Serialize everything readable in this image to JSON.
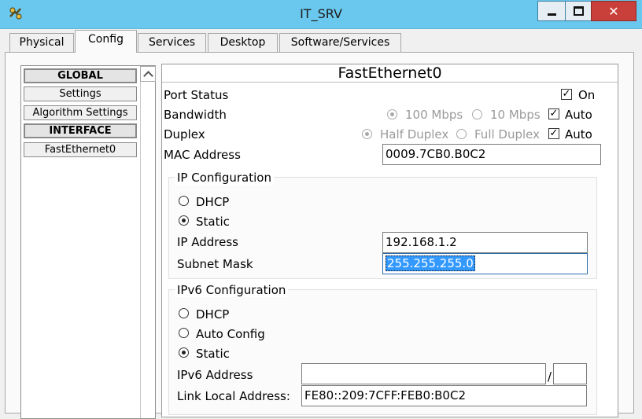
{
  "window": {
    "title": "IT_SRV",
    "close_glyph": "✕"
  },
  "tabs": [
    {
      "label": "Physical"
    },
    {
      "label": "Config"
    },
    {
      "label": "Services"
    },
    {
      "label": "Desktop"
    },
    {
      "label": "Software/Services"
    }
  ],
  "sidebar": {
    "items": [
      {
        "label": "GLOBAL"
      },
      {
        "label": "Settings"
      },
      {
        "label": "Algorithm Settings"
      },
      {
        "label": "INTERFACE"
      },
      {
        "label": "FastEthernet0"
      }
    ]
  },
  "panel": {
    "title": "FastEthernet0",
    "port_status": {
      "label": "Port Status",
      "on_label": "On",
      "checked": true
    },
    "bandwidth": {
      "label": "Bandwidth",
      "opt1": "100 Mbps",
      "opt2": "10 Mbps",
      "auto_label": "Auto"
    },
    "duplex": {
      "label": "Duplex",
      "opt1": "Half Duplex",
      "opt2": "Full Duplex",
      "auto_label": "Auto"
    },
    "mac": {
      "label": "MAC Address",
      "value": "0009.7CB0.B0C2"
    },
    "ip_config": {
      "title": "IP Configuration",
      "dhcp_label": "DHCP",
      "static_label": "Static",
      "ip_label": "IP Address",
      "ip_value": "192.168.1.2",
      "mask_label": "Subnet Mask",
      "mask_value": "255.255.255.0"
    },
    "ipv6_config": {
      "title": "IPv6 Configuration",
      "dhcp_label": "DHCP",
      "auto_label": "Auto Config",
      "static_label": "Static",
      "addr_label": "IPv6 Address",
      "addr_value": "",
      "prefix_value": "",
      "slash": "/",
      "link_label": "Link Local Address:",
      "link_value": "FE80::209:7CFF:FEB0:B0C2"
    }
  },
  "glyphs": {
    "check": "✓"
  },
  "colors": {
    "titlebar": "#6ac8ee",
    "close_button": "#c9403a",
    "selection": "#3399ff"
  }
}
